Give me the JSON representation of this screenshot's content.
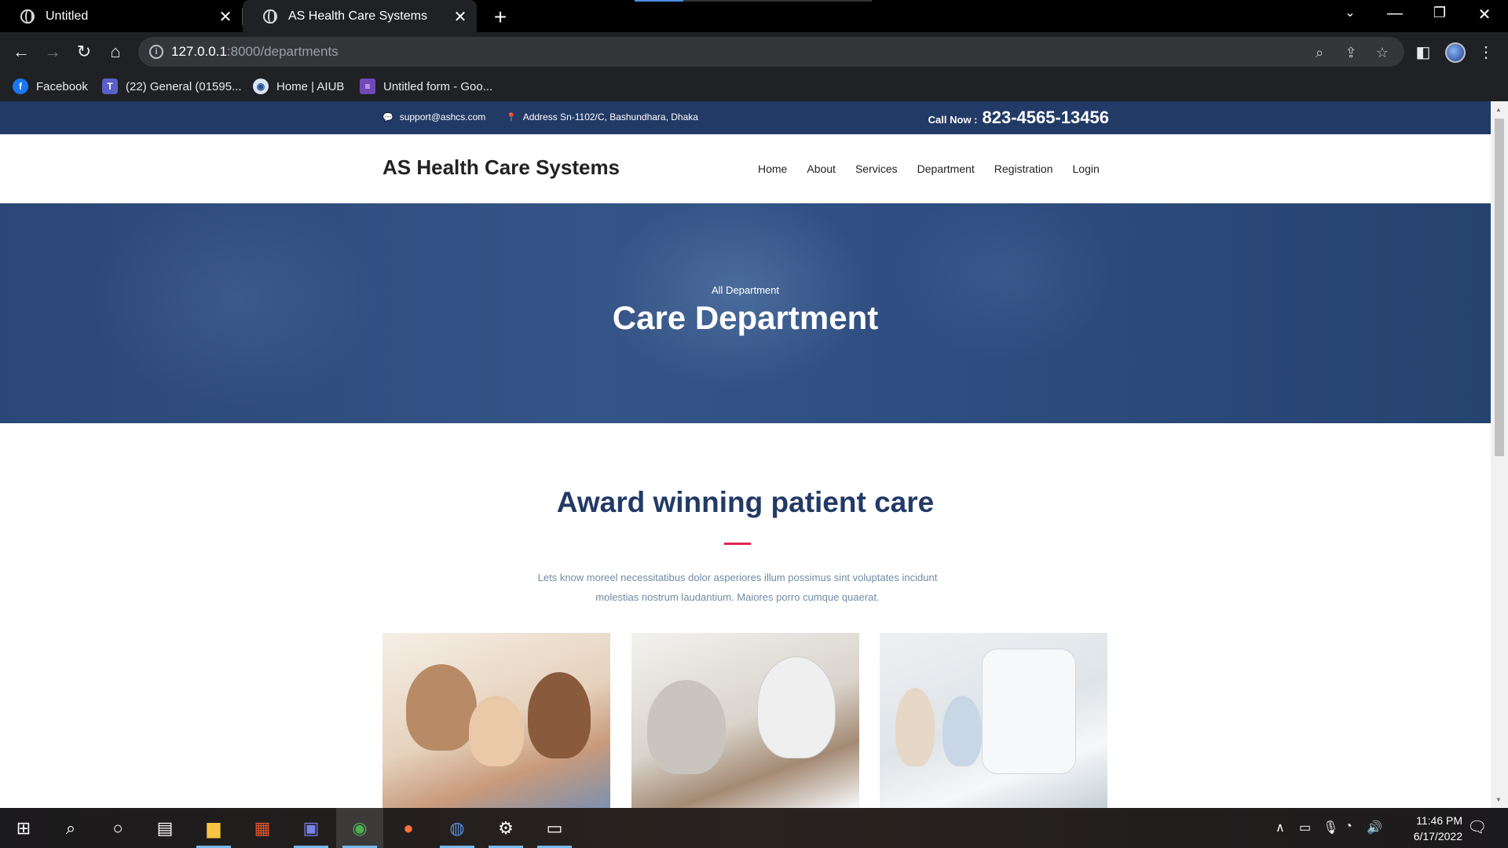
{
  "browser": {
    "tabs": [
      {
        "title": "Untitled"
      },
      {
        "title": "AS Health Care Systems"
      }
    ],
    "url": {
      "host": "127.0.0.1",
      "path": ":8000/departments"
    },
    "bookmarks": [
      {
        "label": "Facebook"
      },
      {
        "label": "(22) General (01595..."
      },
      {
        "label": "Home | AIUB"
      },
      {
        "label": "Untitled form - Goo..."
      }
    ]
  },
  "site": {
    "topbar": {
      "email": "support@ashcs.com",
      "address": "Address Sn-1102/C, Bashundhara, Dhaka",
      "call_label": "Call Now :",
      "call_number": "823-4565-13456"
    },
    "logo": "AS Health Care Systems",
    "nav": [
      "Home",
      "About",
      "Services",
      "Department",
      "Registration",
      "Login"
    ],
    "hero": {
      "subtitle": "All Department",
      "title": "Care Department"
    },
    "section": {
      "title": "Award winning patient care",
      "text": "Lets know moreel necessitatibus dolor asperiores illum possimus sint voluptates incidunt molestias nostrum laudantium. Maiores porro cumque quaerat."
    }
  },
  "taskbar": {
    "time": "11:46 PM",
    "date": "6/17/2022"
  },
  "colors": {
    "primary": "#223a66",
    "accent": "#e12454",
    "muted_text": "#6f8ba4"
  }
}
